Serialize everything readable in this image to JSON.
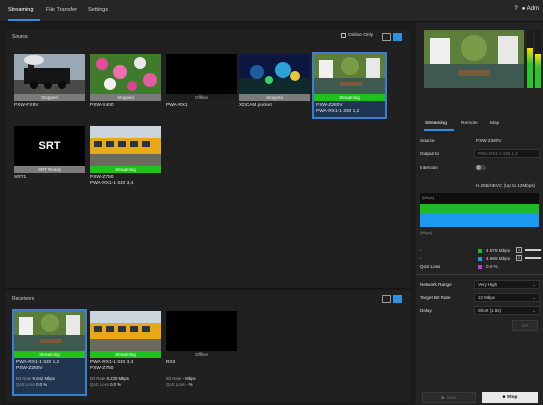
{
  "tabs": [
    {
      "label": "Streaming"
    },
    {
      "label": "File Transfer"
    },
    {
      "label": "Settings"
    }
  ],
  "header": {
    "help": "?",
    "user": "Adm"
  },
  "source": {
    "title": "Source",
    "online_only": "Online Only",
    "tiles": [
      {
        "status": "Stopped",
        "name": "PXW-FX9V"
      },
      {
        "status": "Stopped",
        "name": "PXW-X400"
      },
      {
        "status": "Offline",
        "name": "PWA-RX1"
      },
      {
        "status": "Stopped",
        "name": "XDCAM pocket"
      },
      {
        "status": "Streaming",
        "name": "PXW-Z280V",
        "name2": "PWA-RX1-1 SDI 1,2"
      },
      {
        "status": "SRT Ready",
        "name": "SRT1",
        "thumb_text": "SRT"
      },
      {
        "status": "Streaming",
        "name": "PXW-Z750",
        "name2": "PWA-RX1-1 SDI 3,4"
      }
    ]
  },
  "receivers": {
    "title": "Receivers",
    "tiles": [
      {
        "status": "Streaming",
        "name": "PWA-RX1-1 SDI 1,2",
        "name2": "PXW-Z280V",
        "bit_rate_label": "Bit Rate",
        "bit_rate": "9.042 Mbps",
        "qos_label": "QoS Loss",
        "qos": "0.0 %"
      },
      {
        "status": "Streaming",
        "name": "PWA-RX1-1 SDI 3,4",
        "name2": "PXW-Z750",
        "bit_rate_label": "Bit Rate",
        "bit_rate": "8.230 Mbps",
        "qos_label": "QoS Loss",
        "qos": "0.0 %"
      },
      {
        "status": "Offline",
        "name": "RX3",
        "name2": "",
        "bit_rate_label": "Bit Rate",
        "bit_rate": "- Mbps",
        "qos_label": "QoS Loss",
        "qos": "- %"
      }
    ]
  },
  "right": {
    "tabs": [
      {
        "label": "Streaming"
      },
      {
        "label": "Remote"
      },
      {
        "label": "Map"
      }
    ],
    "source_label": "Source",
    "source_value": "PXW-Z280V",
    "output_label": "Output to",
    "output_value": "PWA-RX1-1 SDI 1,2",
    "intercom_label": "Intercom",
    "codec": "H.265/HEVC (Up to 12Mbps)",
    "graph_top_label": "[Mbps]",
    "graph_bottom_label": "[Mbps]",
    "legend_line1": "-",
    "legend_value1": "4.976 Mbps",
    "legend_line2": "-",
    "legend_value2": "4.966 Mbps",
    "qos_label": "QoS Loss",
    "qos_value": "0.0 %",
    "badge1": "1",
    "badge2": "2",
    "network_label": "Network Range",
    "network_value": "Very High",
    "bitrate_label": "Target Bit Rate",
    "bitrate_value": "12 Mbps",
    "delay_label": "Delay",
    "delay_value": "Short (1.5s)",
    "set_label": "Set",
    "start_label": "Start",
    "stop_label": "Stop"
  },
  "colors": {
    "accent": "#2f8fe0",
    "streaming": "#21c11b",
    "stopped": "#7b7b7b"
  }
}
